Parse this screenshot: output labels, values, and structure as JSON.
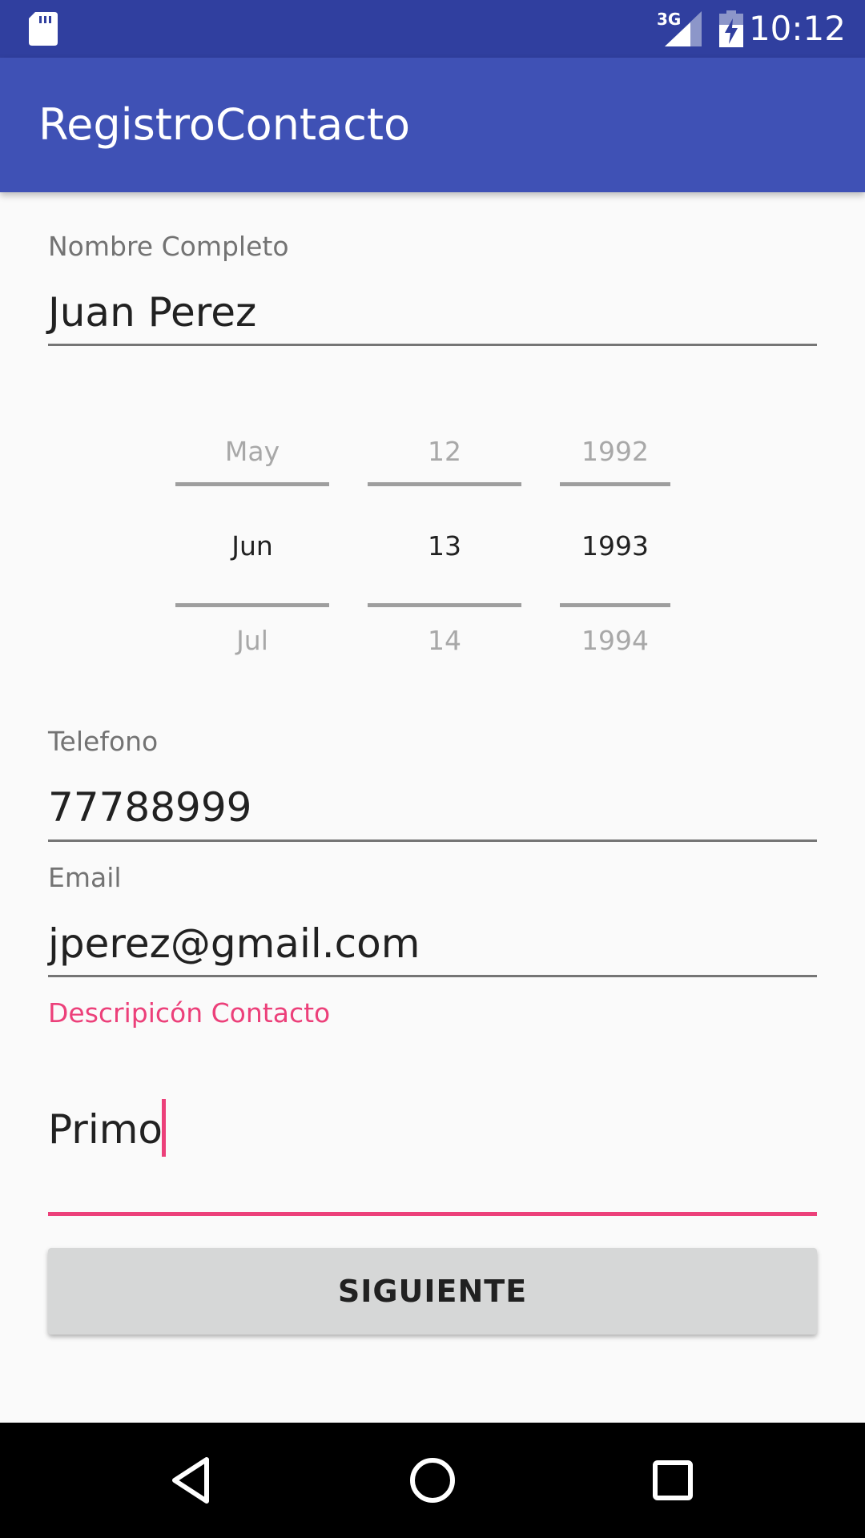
{
  "status_bar": {
    "network": "3G",
    "time": "10:12",
    "icons": [
      "sd-card-icon",
      "signal-icon",
      "battery-charging-icon"
    ]
  },
  "app_bar": {
    "title": "RegistroContacto"
  },
  "form": {
    "name": {
      "label": "Nombre Completo",
      "value": "Juan Perez"
    },
    "date_picker": {
      "month": {
        "prev": "May",
        "selected": "Jun",
        "next": "Jul"
      },
      "day": {
        "prev": "12",
        "selected": "13",
        "next": "14"
      },
      "year": {
        "prev": "1992",
        "selected": "1993",
        "next": "1994"
      }
    },
    "phone": {
      "label": "Telefono",
      "value": "77788999"
    },
    "email": {
      "label": "Email",
      "value": "jperez@gmail.com"
    },
    "description": {
      "label": "Descripicón Contacto",
      "value": "Primo"
    },
    "next_button": "SIGUIENTE"
  },
  "colors": {
    "status_bar": "#303f9f",
    "app_bar": "#3f51b5",
    "accent": "#ec407a",
    "background": "#fafafa"
  },
  "nav_bar": {
    "icons": [
      "back-icon",
      "home-icon",
      "recents-icon"
    ]
  }
}
